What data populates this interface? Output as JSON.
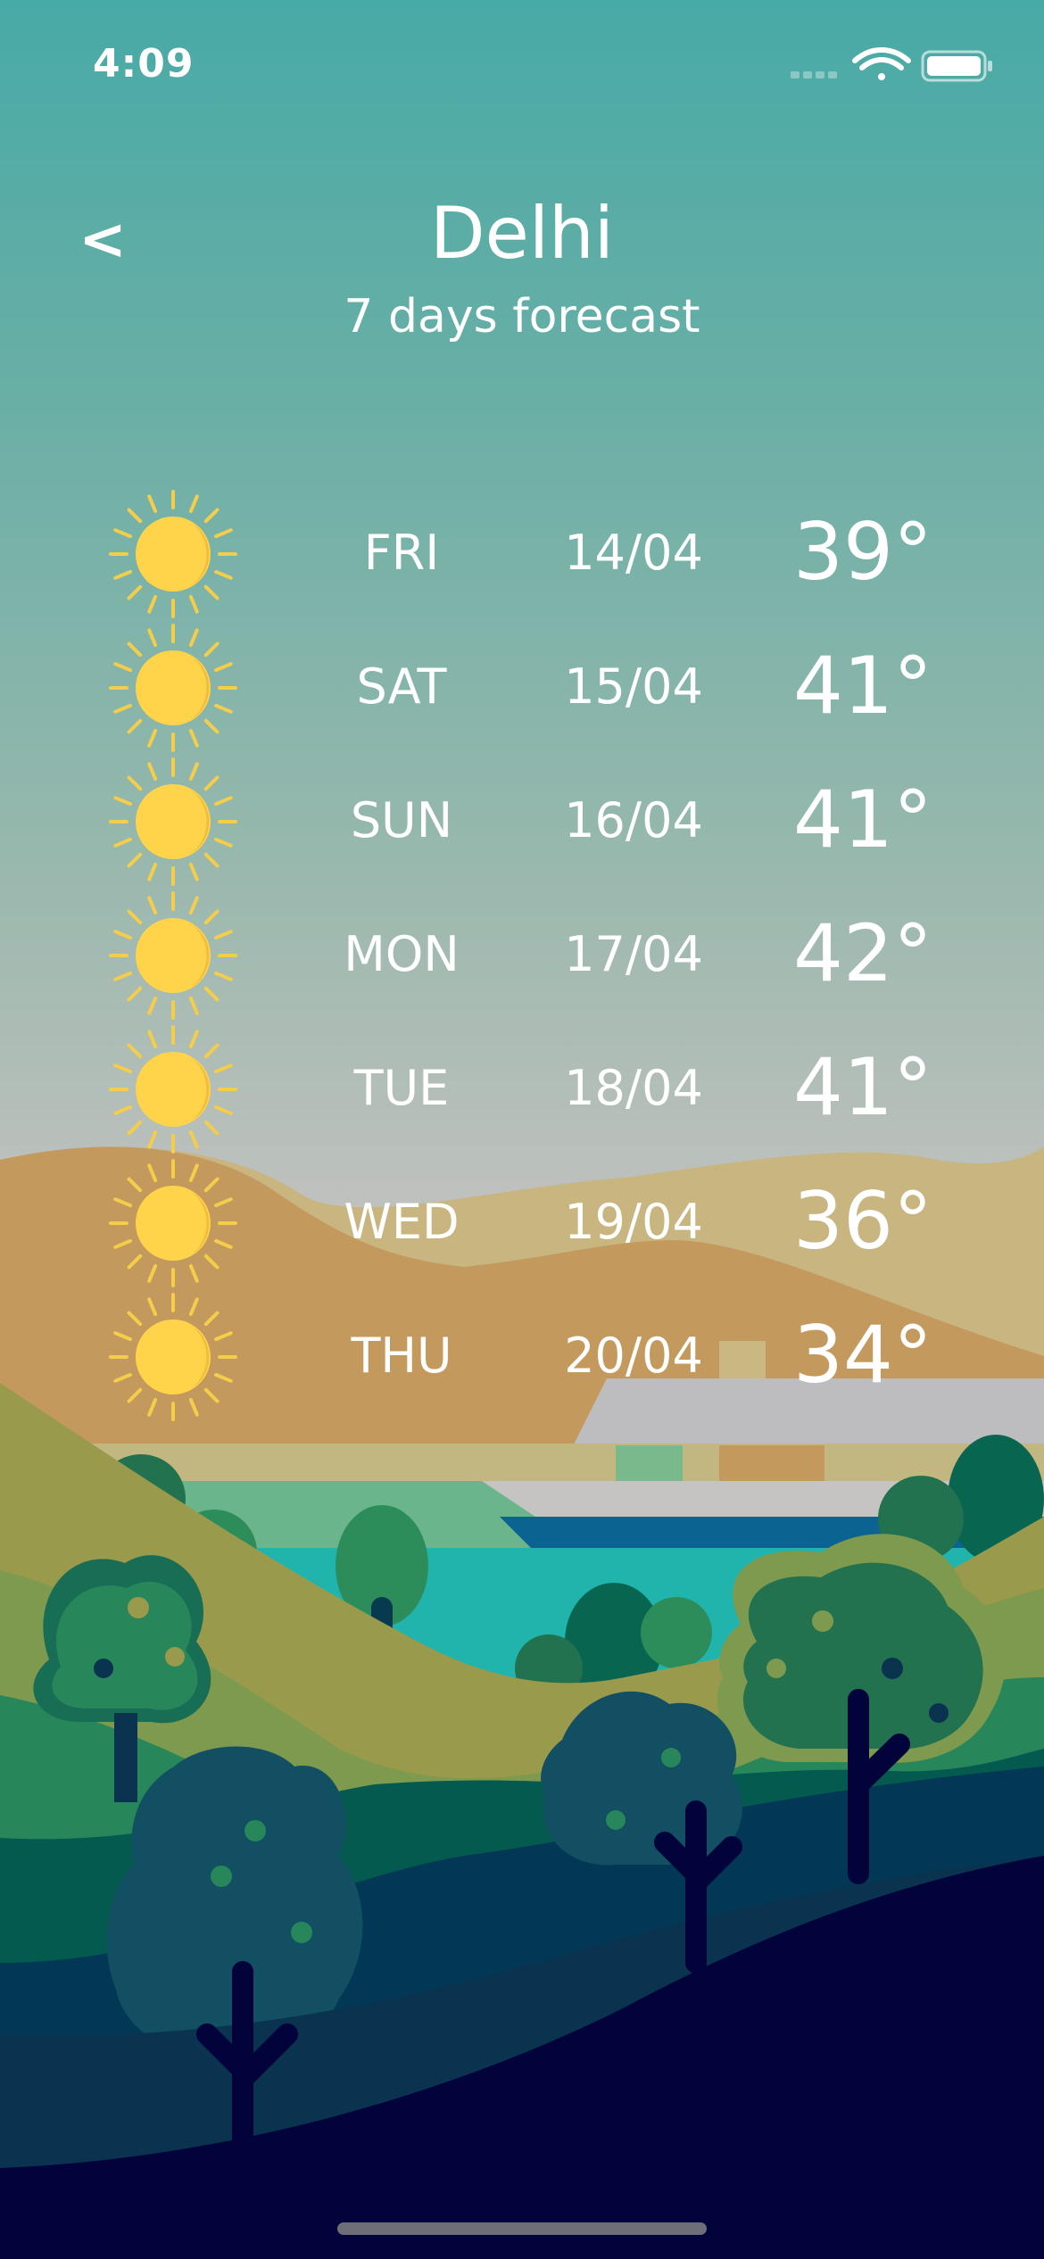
{
  "status_bar": {
    "time": "4:09"
  },
  "header": {
    "back_label": "<",
    "city": "Delhi",
    "subtitle": "7 days forecast"
  },
  "forecast": [
    {
      "day": "FRI",
      "date": "14/04",
      "temp": "39°",
      "icon": "sun-icon"
    },
    {
      "day": "SAT",
      "date": "15/04",
      "temp": "41°",
      "icon": "sun-icon"
    },
    {
      "day": "SUN",
      "date": "16/04",
      "temp": "41°",
      "icon": "sun-icon"
    },
    {
      "day": "MON",
      "date": "17/04",
      "temp": "42°",
      "icon": "sun-icon"
    },
    {
      "day": "TUE",
      "date": "18/04",
      "temp": "41°",
      "icon": "sun-icon"
    },
    {
      "day": "WED",
      "date": "19/04",
      "temp": "36°",
      "icon": "sun-icon"
    },
    {
      "day": "THU",
      "date": "20/04",
      "temp": "34°",
      "icon": "sun-icon"
    }
  ],
  "colors": {
    "sky_top": "#48aaa6",
    "sky_bottom": "#c6c4c2",
    "sun": "#ffd44a",
    "sun_ray": "#f4cd4a",
    "night_ground": "#02033a"
  }
}
